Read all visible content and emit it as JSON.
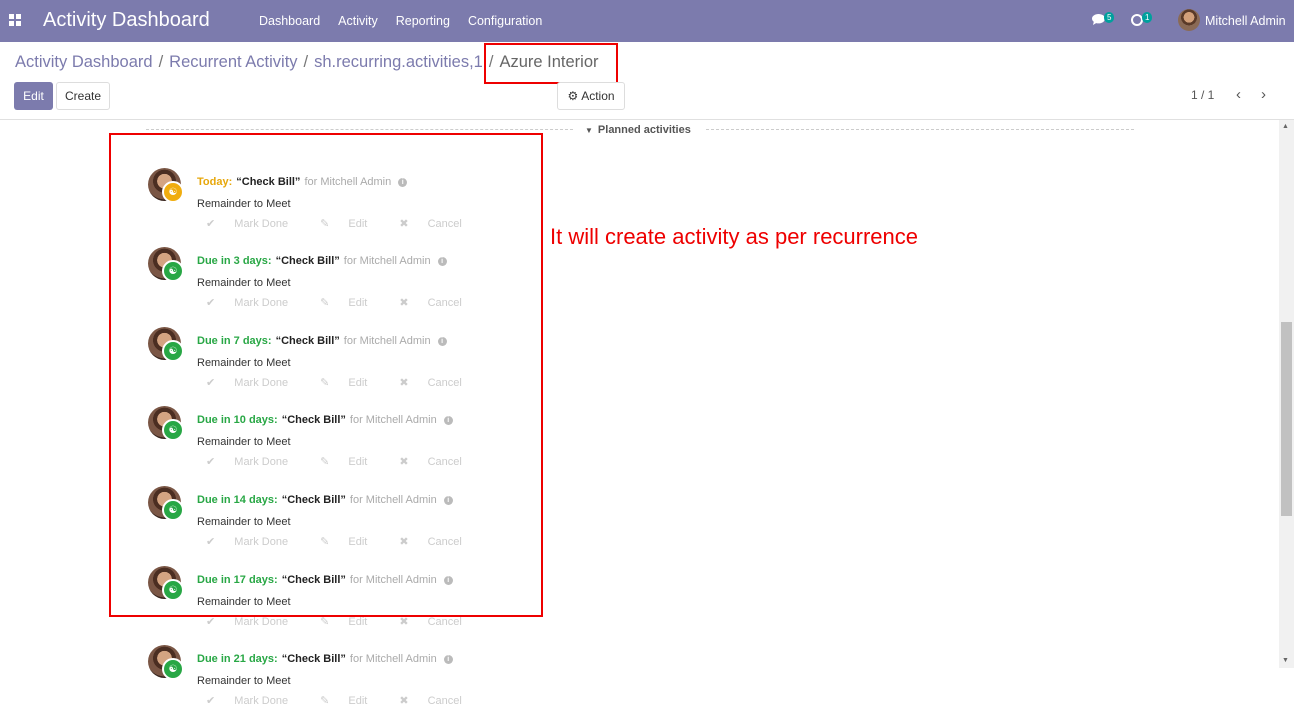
{
  "navbar": {
    "brand": "Activity Dashboard",
    "menu": [
      "Dashboard",
      "Activity",
      "Reporting",
      "Configuration"
    ],
    "chat_count": "5",
    "activity_count": "1",
    "user_name": "Mitchell Admin"
  },
  "breadcrumb": {
    "items": [
      "Activity Dashboard",
      "Recurrent Activity",
      "sh.recurring.activities,1"
    ],
    "separator": "/",
    "current": "Azure Interior"
  },
  "buttons": {
    "edit": "Edit",
    "create": "Create",
    "action": "Action"
  },
  "pager": {
    "value": "1 / 1"
  },
  "planned": {
    "title": "Planned activities"
  },
  "annotation": "It will create activity as per recurrence",
  "activities": [
    {
      "due": "Today:",
      "status": "today",
      "summary": "“Check Bill”",
      "for": "for Mitchell Admin",
      "note": "Remainder to Meet"
    },
    {
      "due": "Due in 3 days:",
      "status": "planned",
      "summary": "“Check Bill”",
      "for": "for Mitchell Admin",
      "note": "Remainder to Meet"
    },
    {
      "due": "Due in 7 days:",
      "status": "planned",
      "summary": "“Check Bill”",
      "for": "for Mitchell Admin",
      "note": "Remainder to Meet"
    },
    {
      "due": "Due in 10 days:",
      "status": "planned",
      "summary": "“Check Bill”",
      "for": "for Mitchell Admin",
      "note": "Remainder to Meet"
    },
    {
      "due": "Due in 14 days:",
      "status": "planned",
      "summary": "“Check Bill”",
      "for": "for Mitchell Admin",
      "note": "Remainder to Meet"
    },
    {
      "due": "Due in 17 days:",
      "status": "planned",
      "summary": "“Check Bill”",
      "for": "for Mitchell Admin",
      "note": "Remainder to Meet"
    },
    {
      "due": "Due in 21 days:",
      "status": "planned",
      "summary": "“Check Bill”",
      "for": "for Mitchell Admin",
      "note": "Remainder to Meet"
    }
  ],
  "activity_actions": {
    "mark_done": "Mark Done",
    "edit": "Edit",
    "cancel": "Cancel"
  },
  "colors": {
    "navbar": "#7c7bad",
    "today": "#e7a70b",
    "planned": "#28a745",
    "highlight": "#ee0000"
  }
}
